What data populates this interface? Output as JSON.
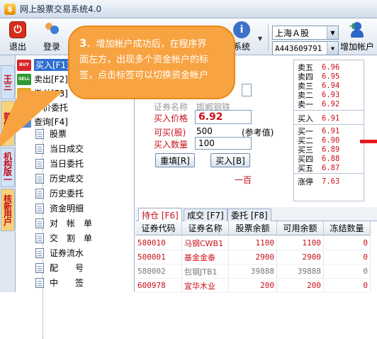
{
  "window": {
    "title": "网上股票交易系统4.0",
    "icon": "app-icon"
  },
  "toolbar": {
    "exit_label": "退出",
    "login_label": "登录",
    "system_label": "系统",
    "add_account_label": "增加帐户",
    "market": "上海Ａ股",
    "account": "A443609791"
  },
  "vtabs": [
    {
      "label": "王三",
      "bg": "#cfe3f9",
      "color": "#c8101a"
    },
    {
      "label": "郭红波",
      "bg": "#f6d37a",
      "color": "#c8101a"
    },
    {
      "label": "机构版一",
      "bg": "#cfe3f9",
      "color": "#c8101a"
    },
    {
      "label": "核新用户",
      "bg": "#f6d37a",
      "color": "#c8101a"
    }
  ],
  "tree": {
    "top_items": [
      {
        "label": "买入[F1]",
        "icon": "buy-icon",
        "icon_bg": "#d7262a",
        "icon_text": "BUY",
        "selected": true
      },
      {
        "label": "卖出[F2]",
        "icon": "sell-icon",
        "icon_bg": "#2d9a35",
        "icon_text": "SELL",
        "selected": false
      },
      {
        "label": "撤单[F3]",
        "icon": "cancel-hand-icon",
        "icon_bg": "#e6a626",
        "icon_text": "✋",
        "selected": false
      },
      {
        "label": "市价委托",
        "icon": "market-order-icon",
        "icon_bg": "#d7262a",
        "icon_text": "◆",
        "selected": false
      },
      {
        "label": "查询[F4]",
        "icon": "query-icon",
        "icon_bg": "#5c86c4",
        "icon_text": "🔍",
        "selected": false
      }
    ],
    "sub_items": [
      "股票",
      "当日成交",
      "当日委托",
      "历史成交",
      "历史委托",
      "资金明细",
      "对　帐　单",
      "交　割　单",
      "证券流水",
      "配　　号",
      "中　　签"
    ]
  },
  "form": {
    "stock_name_label": "证券名称",
    "stock_name_value": "邯郸钢铁",
    "price_label": "买入价格",
    "price_value": "6.92",
    "can_buy_label": "可买(股)",
    "can_buy_value": "500",
    "ref_label": "(参考值)",
    "qty_label": "买入数量",
    "qty_value": "100",
    "reset_button": "重填[R]",
    "buy_button": "买入[B]",
    "unit_text": "一百"
  },
  "quote": {
    "sell": [
      {
        "name": "卖五",
        "price": "6.96"
      },
      {
        "name": "卖四",
        "price": "6.95"
      },
      {
        "name": "卖三",
        "price": "6.94"
      },
      {
        "name": "卖二",
        "price": "6.93"
      },
      {
        "name": "卖一",
        "price": "6.92"
      }
    ],
    "buy_now": {
      "name": "买入",
      "price": "6.91"
    },
    "buy": [
      {
        "name": "买一",
        "price": "6.91"
      },
      {
        "name": "买二",
        "price": "6.90"
      },
      {
        "name": "买三",
        "price": "6.89"
      },
      {
        "name": "买四",
        "price": "6.88"
      },
      {
        "name": "买五",
        "price": "6.87"
      }
    ],
    "limit_up": {
      "name": "涨停",
      "price": "7.63"
    }
  },
  "bottom_tabs": [
    {
      "label": "持仓 [F6]",
      "active": true
    },
    {
      "label": "成交 [F7]",
      "active": false
    },
    {
      "label": "委托 [F8]",
      "active": false
    }
  ],
  "holdings": {
    "columns": [
      "证券代码",
      "证券名称",
      "股票余额",
      "可用余额",
      "冻结数量"
    ],
    "rows": [
      {
        "code": "580010",
        "name": "马钢CWB1",
        "balance": "1100",
        "available": "1100",
        "frozen": "0",
        "style": "red"
      },
      {
        "code": "500001",
        "name": "基金金泰",
        "balance": "2900",
        "available": "2900",
        "frozen": "0",
        "style": "red"
      },
      {
        "code": "580002",
        "name": "包钢JTB1",
        "balance": "39888",
        "available": "39888",
        "frozen": "0",
        "style": "gray"
      },
      {
        "code": "600978",
        "name": "宜华木业",
        "balance": "200",
        "available": "200",
        "frozen": "0",
        "style": "red"
      }
    ]
  },
  "callout": {
    "step": "3",
    "line1": "、增加帐户成功后，在程序界",
    "line2": "面左方，出现多个资金帐户的标",
    "line3": "签，点击标签可以切换资金帐户"
  }
}
